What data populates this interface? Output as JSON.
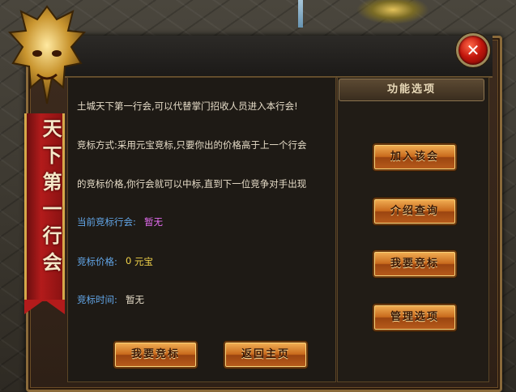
{
  "banner": {
    "title": "天下第一行会"
  },
  "right_panel": {
    "title": "功能选项",
    "buttons": [
      "加入该会",
      "介绍查询",
      "我要竞标",
      "管理选项"
    ]
  },
  "left_panel": {
    "lines": [
      "土城天下第一行会,可以代替掌门招收人员进入本行会!",
      "竞标方式:采用元宝竞标,只要你出的价格高于上一个行会",
      "的竞标价格,你行会就可以中标,直到下一位竞争对手出现"
    ],
    "current_guild_label": "当前竞标行会:",
    "current_guild_value": "暂无",
    "bid_price_label": "竞标价格:",
    "bid_price_value": "0",
    "bid_price_unit": "元宝",
    "bid_time_label": "竞标时间:",
    "bid_time_value": "暂无"
  },
  "bottom_buttons": {
    "bid": "我要竞标",
    "back": "返回主页"
  },
  "close_icon": "close-icon",
  "colors": {
    "button_orange": "#c86a1c",
    "text_blue": "#62a6e8",
    "text_pink": "#e36cf0",
    "text_yellow": "#f3d44a",
    "banner_red": "#b31b1b"
  }
}
